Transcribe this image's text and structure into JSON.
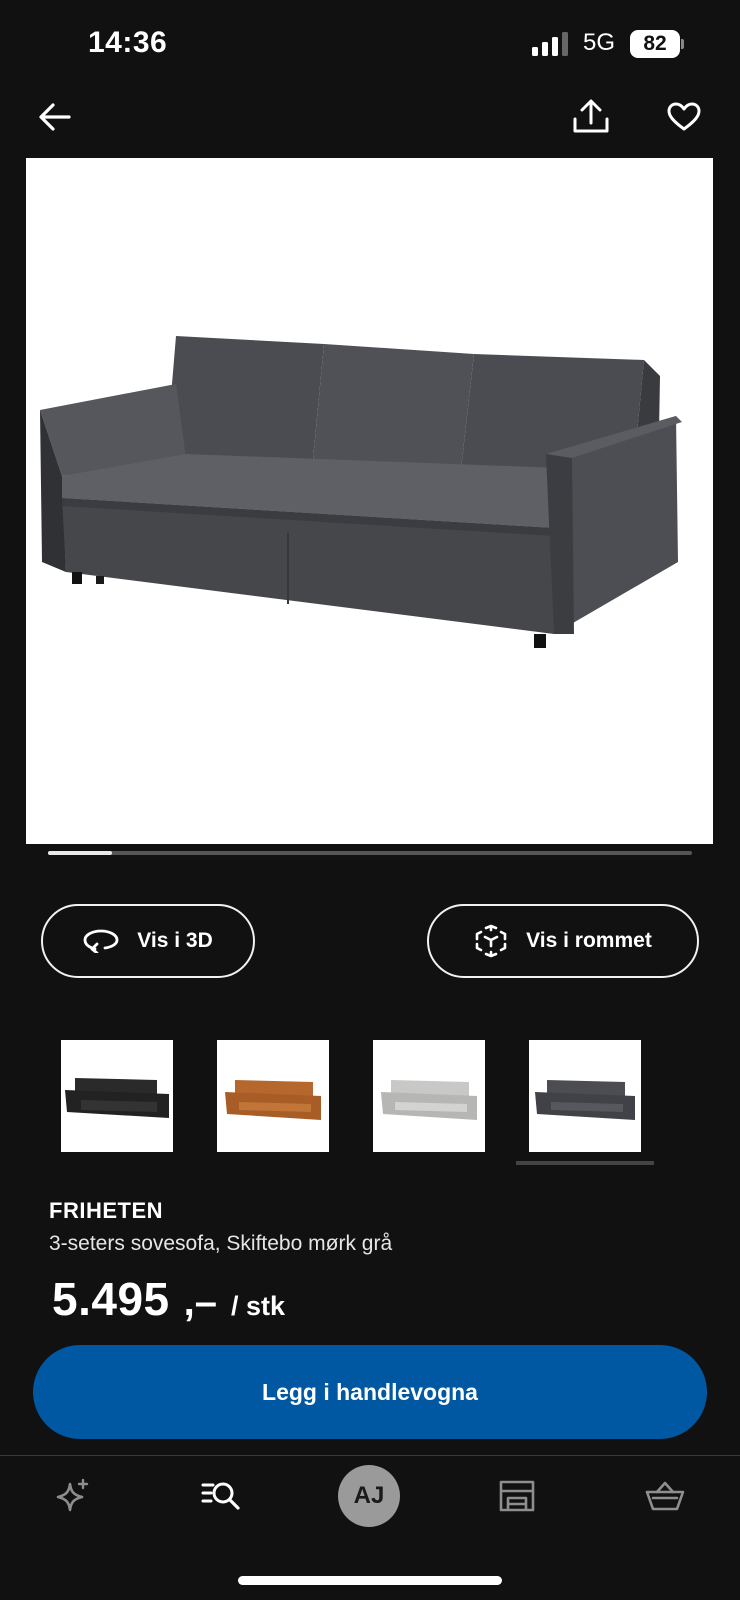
{
  "status_bar": {
    "time": "14:36",
    "network": "5G",
    "battery": "82"
  },
  "product": {
    "name": "FRIHETEN",
    "description": "3-seters sovesofa, Skiftebo mørk grå",
    "price": "5.495",
    "price_suffix": ",–",
    "price_unit": "/ stk",
    "image_carousel_progress": 0.1
  },
  "actions": {
    "view_3d": "Vis i 3D",
    "view_in_room": "Vis i rommet",
    "add_to_cart": "Legg i handlevogna"
  },
  "variants": [
    {
      "color": "#2a2a2a",
      "name": "black"
    },
    {
      "color": "#b5672d",
      "name": "orange"
    },
    {
      "color": "#c8c9c6",
      "name": "light grey"
    },
    {
      "color": "#4b4d52",
      "name": "dark grey",
      "selected": true
    }
  ],
  "tab_bar": {
    "avatar_initials": "AJ"
  },
  "colors": {
    "accent": "#0058a3",
    "background": "#111111"
  }
}
